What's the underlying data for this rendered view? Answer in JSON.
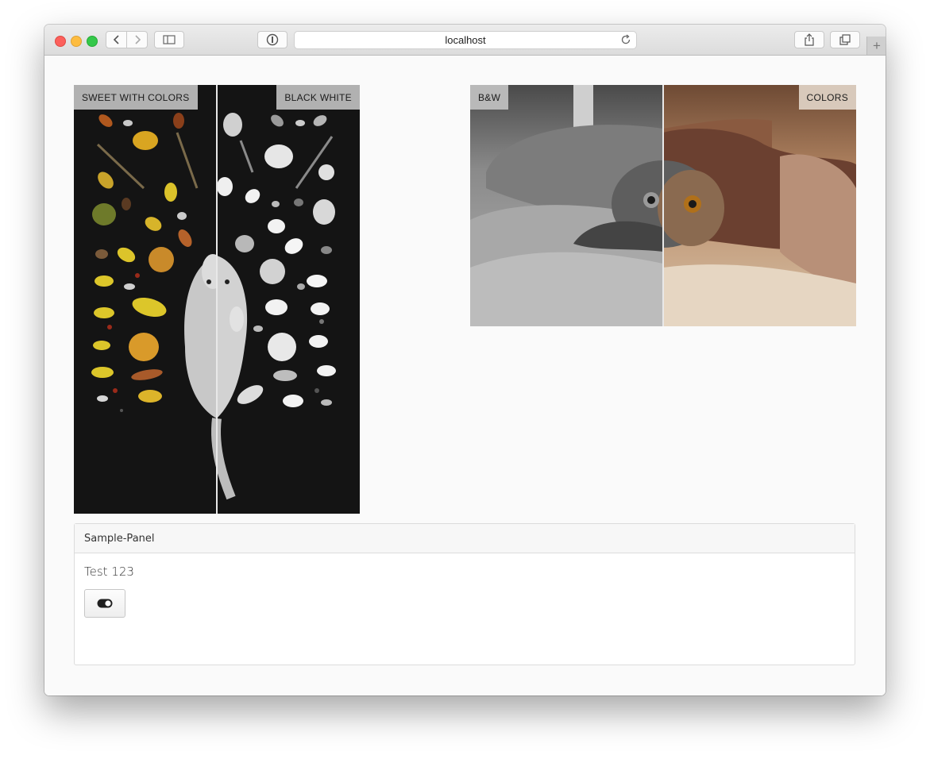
{
  "browser": {
    "url": "localhost"
  },
  "comparisons": [
    {
      "left_label": "SWEET WITH COLORS",
      "right_label": "BLACK WHITE",
      "divider_position": 0.5
    },
    {
      "left_label": "B&W",
      "right_label": "COLORS",
      "divider_position": 0.5
    }
  ],
  "panel": {
    "title": "Sample-Panel",
    "body_text": "Test 123",
    "button_icon": "toggle-icon"
  }
}
